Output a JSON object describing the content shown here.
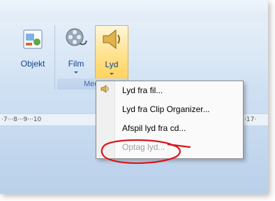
{
  "ribbon": {
    "objekt_label": "Objekt",
    "film_label": "Film",
    "lyd_label": "Lyd",
    "group_label": "Medi"
  },
  "ruler": {
    "left_text": "·7···8···9···10",
    "right_text": "·17·"
  },
  "menu": {
    "items": [
      {
        "label": "Lyd fra fil...",
        "enabled": true
      },
      {
        "label": "Lyd fra Clip Organizer...",
        "enabled": true
      },
      {
        "label": "Afspil lyd fra cd...",
        "enabled": true
      },
      {
        "label": "Optag lyd...",
        "enabled": false
      }
    ]
  },
  "colors": {
    "accent_hover": "#ffd35a",
    "annotation": "#d9151d",
    "ribbon_text": "#15428b"
  }
}
